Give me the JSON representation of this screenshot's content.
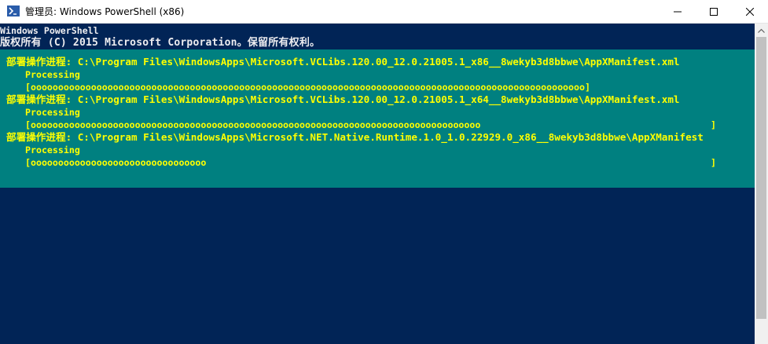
{
  "window": {
    "title": "管理员: Windows PowerShell (x86)",
    "icons": {
      "app": "powershell-icon",
      "minimize": "minimize-icon",
      "maximize": "maximize-icon",
      "close": "close-icon"
    }
  },
  "console": {
    "header": [
      "Windows PowerShell",
      "版权所有 (C) 2015 Microsoft Corporation。保留所有权利。"
    ],
    "operations": [
      {
        "operation": "部署操作进程: C:\\Program Files\\WindowsApps\\Microsoft.VCLibs.120.00_12.0.21005.1_x86__8wekyb3d8bbwe\\AppXManifest.xml",
        "status": "Processing",
        "bar": "[ooooooooooooooooooooooooooooooooooooooooooooooooooooooooooooooooooooooooooooooooooooooooooooooooooooo]",
        "bar_close": "",
        "progress": 1.0
      },
      {
        "operation": "部署操作进程: C:\\Program Files\\WindowsApps\\Microsoft.VCLibs.120.00_12.0.21005.1_x64__8wekyb3d8bbwe\\AppXManifest.xml",
        "status": "Processing",
        "bar": "[oooooooooooooooooooooooooooooooooooooooooooooooooooooooooooooooooooooooooooooooooo",
        "bar_close": "]",
        "progress": 0.82
      },
      {
        "operation": "部署操作进程: C:\\Program Files\\WindowsApps\\Microsoft.NET.Native.Runtime.1.0_1.0.22929.0_x86__8wekyb3d8bbwe\\AppXManifest",
        "status": "Processing",
        "bar": "[oooooooooooooooooooooooooooooooo",
        "bar_close": "]",
        "progress": 0.32
      }
    ]
  },
  "colors": {
    "console_background": "#012456",
    "progress_background": "#008080",
    "progress_text": "#ffff00",
    "header_text": "#eeedf0"
  }
}
